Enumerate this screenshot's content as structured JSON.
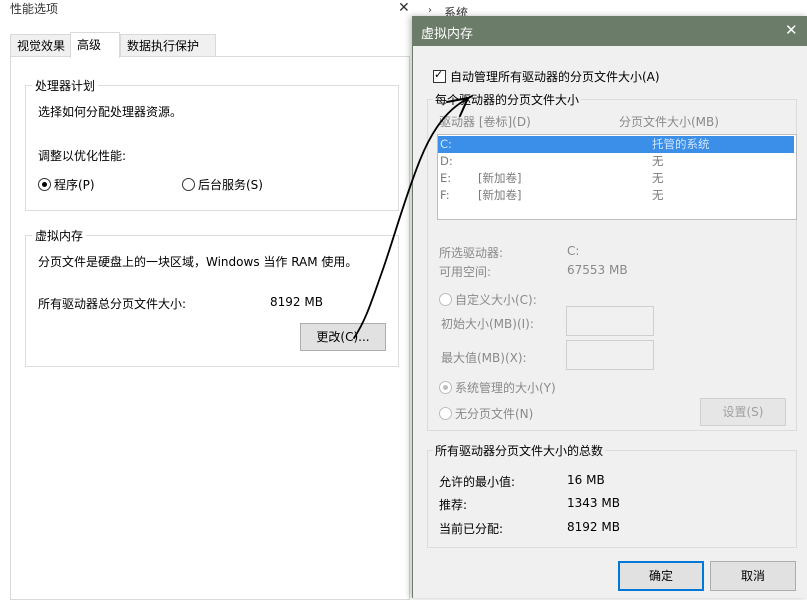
{
  "perf_window": {
    "title": "性能选项",
    "close_glyph": "✕",
    "tabs": [
      "视觉效果",
      "高级",
      "数据执行保护"
    ],
    "processor_group": {
      "label": "处理器计划",
      "desc": "选择如何分配处理器资源。",
      "adjust_label": "调整以优化性能:",
      "radio_programs": "程序(P)",
      "radio_background": "后台服务(S)"
    },
    "vm_group": {
      "label": "虚拟内存",
      "desc": "分页文件是硬盘上的一块区域，Windows 当作 RAM 使用。",
      "total_label": "所有驱动器总分页文件大小:",
      "total_value": "8192 MB",
      "change_button": "更改(C)..."
    }
  },
  "bg_window": {
    "title_fragment": "系统"
  },
  "vm_dialog": {
    "title": "虚拟内存",
    "close_glyph": "✕",
    "auto_manage_label": "自动管理所有驱动器的分页文件大小(A)",
    "per_drive_group_label": "每个驱动器的分页文件大小",
    "col_drive": "驱动器 [卷标](D)",
    "col_size": "分页文件大小(MB)",
    "drives": [
      {
        "drive": "C:",
        "label": "",
        "size": "托管的系统",
        "selected": true
      },
      {
        "drive": "D:",
        "label": "",
        "size": "无",
        "selected": false
      },
      {
        "drive": "E:",
        "label": "[新加卷]",
        "size": "无",
        "selected": false
      },
      {
        "drive": "F:",
        "label": "[新加卷]",
        "size": "无",
        "selected": false
      }
    ],
    "selected_drive_label": "所选驱动器:",
    "selected_drive_value": "C:",
    "free_space_label": "可用空间:",
    "free_space_value": "67553 MB",
    "custom_size_label": "自定义大小(C):",
    "initial_size_label": "初始大小(MB)(I):",
    "max_size_label": "最大值(MB)(X):",
    "system_managed_label": "系统管理的大小(Y)",
    "no_paging_label": "无分页文件(N)",
    "set_button": "设置(S)",
    "totals_group_label": "所有驱动器分页文件大小的总数",
    "min_allowed_label": "允许的最小值:",
    "min_allowed_value": "16 MB",
    "recommended_label": "推荐:",
    "recommended_value": "1343 MB",
    "current_label": "当前已分配:",
    "current_value": "8192 MB",
    "ok_button": "确定",
    "cancel_button": "取消"
  },
  "colors": {
    "dialog_titlebar": "#6b7c68",
    "selection": "#3b8fe8",
    "dialog_bg": "#f0f0f0"
  }
}
